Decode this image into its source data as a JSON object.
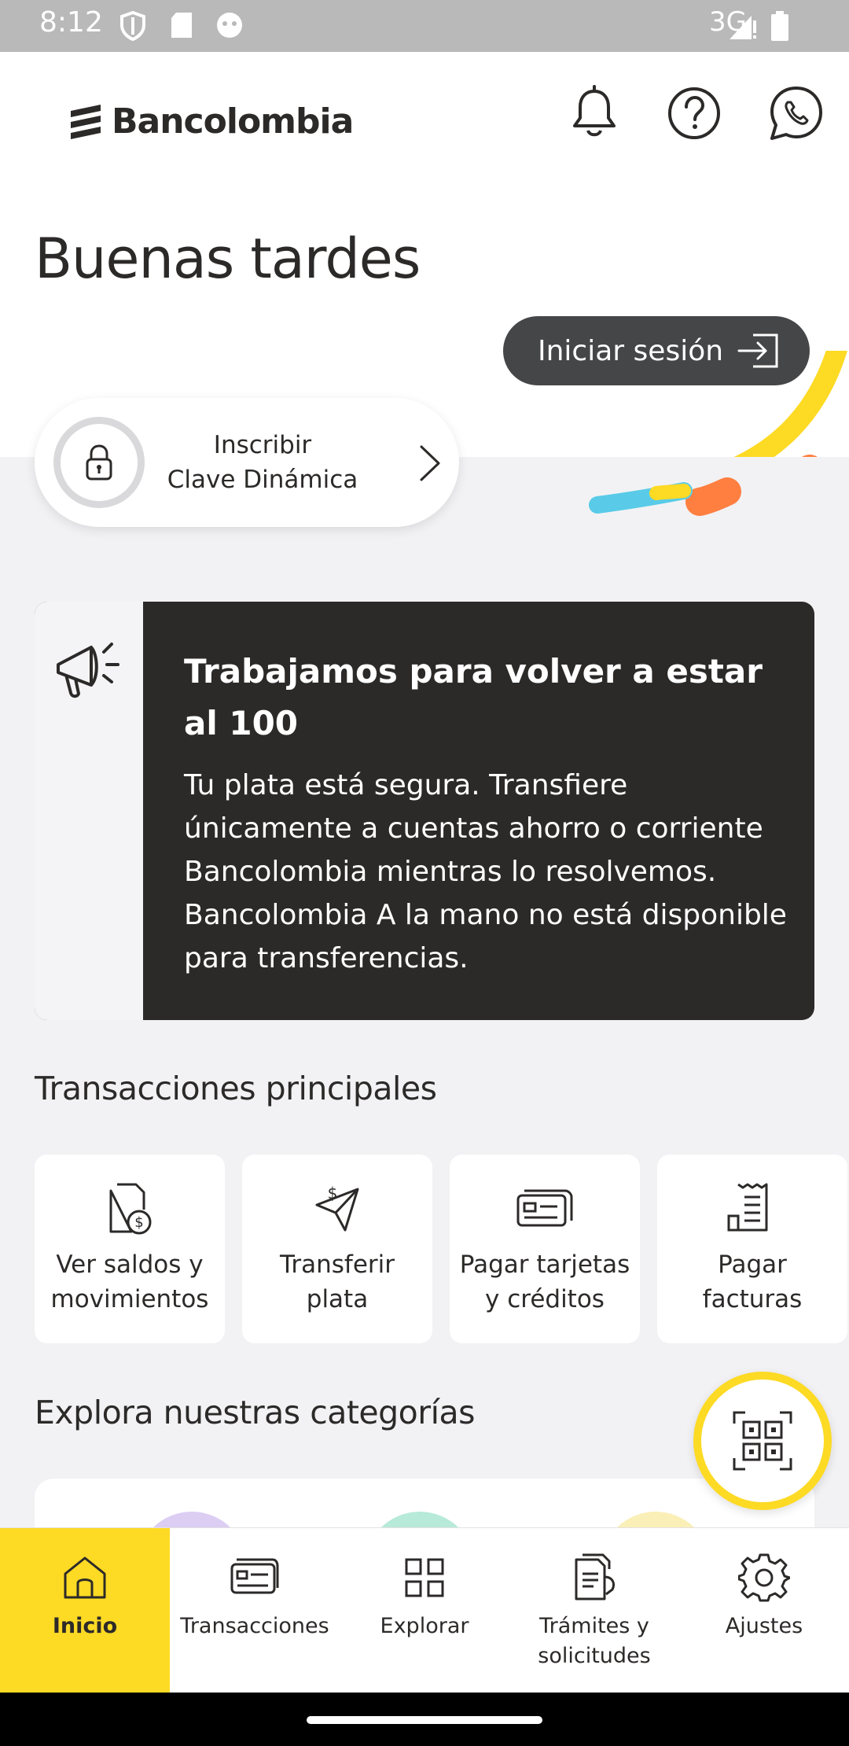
{
  "status_bar": {
    "time": "8:12",
    "network": "3G"
  },
  "header": {
    "brand": "Bancolombia",
    "greeting": "Buenas tardes",
    "login_label": "Iniciar sesión",
    "icons": [
      "bell-icon",
      "help-icon",
      "whatsapp-icon"
    ]
  },
  "clave": {
    "line1": "Inscribir",
    "line2": "Clave Dinámica"
  },
  "alert": {
    "title": "Trabajamos para volver a estar al 100",
    "body": "Tu plata está segura. Transfiere únicamente a cuentas ahorro o corriente Bancolombia mientras lo resolvemos. Bancolombia A la mano no está disponible para transferencias."
  },
  "transactions": {
    "title": "Transacciones principales",
    "items": [
      {
        "line1": "Ver saldos y",
        "line2": "movimientos",
        "icon": "document-money-icon"
      },
      {
        "line1": "Transferir",
        "line2": "plata",
        "icon": "send-money-icon"
      },
      {
        "line1": "Pagar tarjetas",
        "line2": "y créditos",
        "icon": "cards-icon"
      },
      {
        "line1": "Pagar",
        "line2": "facturas",
        "icon": "receipt-icon"
      }
    ]
  },
  "explore": {
    "title": "Explora nuestras categorías"
  },
  "nav": {
    "items": [
      {
        "line1": "Inicio",
        "line2": "",
        "icon": "home-icon",
        "active": true
      },
      {
        "line1": "Transacciones",
        "line2": "",
        "icon": "card-icon",
        "active": false
      },
      {
        "line1": "Explorar",
        "line2": "",
        "icon": "grid-icon",
        "active": false
      },
      {
        "line1": "Trámites y",
        "line2": "solicitudes",
        "icon": "documents-icon",
        "active": false
      },
      {
        "line1": "Ajustes",
        "line2": "",
        "icon": "gear-icon",
        "active": false
      }
    ]
  },
  "colors": {
    "brand_yellow": "#fdda24",
    "dark": "#2c2a29",
    "orange": "#ff7f41",
    "cyan": "#59cbe8"
  }
}
